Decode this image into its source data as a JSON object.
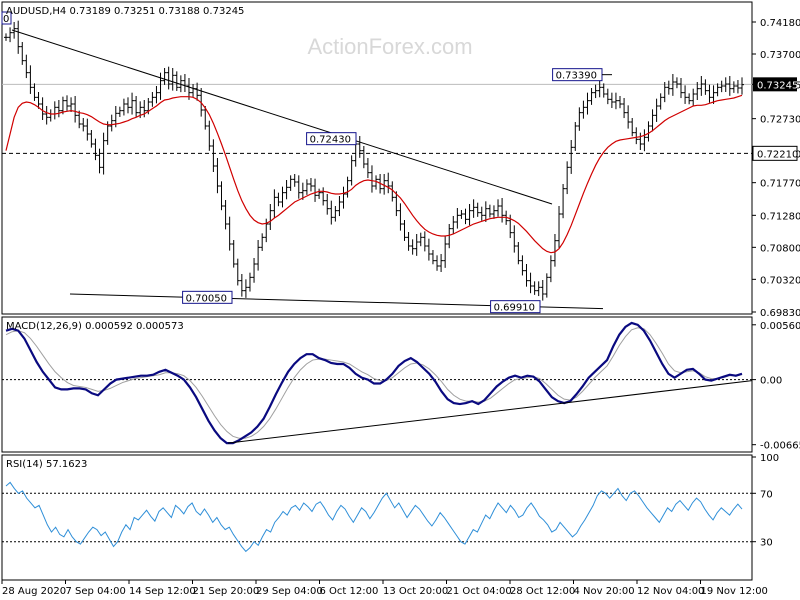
{
  "chart_data": [
    {
      "type": "candlestick",
      "title": "AUDUSD,H4  0.73189 0.73251 0.73188 0.73245",
      "corner_tag": "0",
      "ylim": [
        0.6983,
        0.7445
      ],
      "yticks": [
        "0.74180",
        "0.73700",
        "0.73245",
        "0.72730",
        "0.72210",
        "0.71770",
        "0.71280",
        "0.70800",
        "0.70320",
        "0.69830"
      ],
      "current_price_label": "0.73245",
      "marked_level_label": "0.72210",
      "annotations": [
        "0.73390",
        "0.72430",
        "0.70050",
        "0.69910"
      ],
      "close_series": [
        0.7395,
        0.7402,
        0.7408,
        0.7381,
        0.736,
        0.7342,
        0.732,
        0.7305,
        0.7295,
        0.728,
        0.7275,
        0.728,
        0.729,
        0.7285,
        0.73,
        0.7292,
        0.7295,
        0.7278,
        0.7265,
        0.7262,
        0.725,
        0.7235,
        0.7218,
        0.72,
        0.724,
        0.7262,
        0.727,
        0.7281,
        0.7285,
        0.7295,
        0.729,
        0.73,
        0.7282,
        0.729,
        0.7285,
        0.7298,
        0.7305,
        0.7312,
        0.733,
        0.7342,
        0.7325,
        0.7338,
        0.732,
        0.733,
        0.7322,
        0.7312,
        0.7318,
        0.7308,
        0.7286,
        0.7262,
        0.7232,
        0.7202,
        0.7172,
        0.7142,
        0.7115,
        0.7085,
        0.7055,
        0.703,
        0.7015,
        0.702,
        0.7035,
        0.7055,
        0.708,
        0.7095,
        0.7115,
        0.7135,
        0.7155,
        0.7148,
        0.7162,
        0.717,
        0.7182,
        0.7178,
        0.7162,
        0.7165,
        0.7175,
        0.7172,
        0.7158,
        0.7162,
        0.715,
        0.7138,
        0.7125,
        0.7135,
        0.7148,
        0.716,
        0.718,
        0.721,
        0.7235,
        0.7225,
        0.7205,
        0.7192,
        0.7172,
        0.7182,
        0.7168,
        0.718,
        0.7172,
        0.7155,
        0.7135,
        0.7115,
        0.7095,
        0.7082,
        0.7078,
        0.7088,
        0.7095,
        0.7082,
        0.707,
        0.706,
        0.7052,
        0.706,
        0.7085,
        0.7108,
        0.7118,
        0.7128,
        0.713,
        0.7122,
        0.7135,
        0.714,
        0.7132,
        0.7128,
        0.7138,
        0.713,
        0.7135,
        0.7142,
        0.7128,
        0.712,
        0.7102,
        0.7082,
        0.706,
        0.7045,
        0.703,
        0.7022,
        0.7015,
        0.702,
        0.701,
        0.7035,
        0.706,
        0.709,
        0.713,
        0.7168,
        0.72,
        0.723,
        0.7262,
        0.7282,
        0.729,
        0.73,
        0.7312,
        0.7315,
        0.732,
        0.731,
        0.7302,
        0.7298,
        0.73,
        0.7295,
        0.7282,
        0.7268,
        0.7252,
        0.7242,
        0.7235,
        0.7245,
        0.7262,
        0.7278,
        0.7292,
        0.7305,
        0.732,
        0.7318,
        0.7328,
        0.7325,
        0.7312,
        0.7305,
        0.73,
        0.731,
        0.7318,
        0.7325,
        0.7315,
        0.7305,
        0.7312,
        0.732,
        0.7322,
        0.7325,
        0.7318,
        0.7322,
        0.7319,
        0.7324
      ],
      "ma_series": [
        0.7225,
        0.725,
        0.7275,
        0.729,
        0.7296,
        0.7298,
        0.7297,
        0.7294,
        0.729,
        0.7285,
        0.7282,
        0.728,
        0.728,
        0.7281,
        0.7283,
        0.7284,
        0.7285,
        0.7284,
        0.7282,
        0.7281,
        0.7279,
        0.7276,
        0.7272,
        0.7268,
        0.7265,
        0.7264,
        0.7264,
        0.7265,
        0.7266,
        0.7268,
        0.727,
        0.7273,
        0.7275,
        0.7278,
        0.728,
        0.7284,
        0.7288,
        0.7292,
        0.7297,
        0.7301,
        0.7302,
        0.7304,
        0.7305,
        0.7306,
        0.7306,
        0.7306,
        0.7305,
        0.7302,
        0.7297,
        0.7289,
        0.7279,
        0.7266,
        0.7251,
        0.7235,
        0.7218,
        0.72,
        0.7182,
        0.7165,
        0.715,
        0.7138,
        0.7128,
        0.7121,
        0.7117,
        0.7115,
        0.7116,
        0.7119,
        0.7124,
        0.7128,
        0.7133,
        0.7138,
        0.7143,
        0.7148,
        0.7151,
        0.7154,
        0.7157,
        0.716,
        0.7162,
        0.7164,
        0.7164,
        0.7163,
        0.7161,
        0.716,
        0.716,
        0.7161,
        0.7163,
        0.7167,
        0.7173,
        0.7177,
        0.718,
        0.7181,
        0.718,
        0.7179,
        0.7176,
        0.7173,
        0.717,
        0.7166,
        0.716,
        0.7154,
        0.7146,
        0.7137,
        0.7128,
        0.712,
        0.7113,
        0.7107,
        0.7103,
        0.71,
        0.7098,
        0.7097,
        0.7097,
        0.7098,
        0.71,
        0.7103,
        0.7106,
        0.7109,
        0.7112,
        0.7115,
        0.7117,
        0.7119,
        0.7121,
        0.7123,
        0.7124,
        0.7125,
        0.7125,
        0.7125,
        0.7123,
        0.712,
        0.7116,
        0.711,
        0.7104,
        0.7097,
        0.709,
        0.7084,
        0.7078,
        0.7074,
        0.7072,
        0.7073,
        0.7078,
        0.7087,
        0.7099,
        0.7113,
        0.7129,
        0.7145,
        0.7161,
        0.7176,
        0.719,
        0.7203,
        0.7214,
        0.7223,
        0.723,
        0.7235,
        0.7239,
        0.7241,
        0.7242,
        0.7243,
        0.7244,
        0.7245,
        0.7246,
        0.7248,
        0.7251,
        0.7255,
        0.726,
        0.7265,
        0.727,
        0.7274,
        0.7277,
        0.728,
        0.7283,
        0.7286,
        0.7289,
        0.7292,
        0.7293,
        0.7293,
        0.7294,
        0.7296,
        0.7298,
        0.73,
        0.7301,
        0.7302,
        0.7303,
        0.7304,
        0.7306,
        0.7308
      ]
    },
    {
      "type": "line",
      "title": "MACD(12,26,9) 0.000592 0.000573",
      "ylim": [
        -0.0072,
        0.0062
      ],
      "yticks": [
        "0.005607",
        "0.00",
        "-0.006656"
      ],
      "macd_series": [
        0.005,
        0.0052,
        0.005,
        0.0042,
        0.003,
        0.0018,
        0.0008,
        0.0,
        -0.0008,
        -0.001,
        -0.001,
        -0.0009,
        -0.0009,
        -0.001,
        -0.0014,
        -0.0016,
        -0.001,
        -0.0004,
        0.0,
        0.0001,
        0.0002,
        0.0003,
        0.0004,
        0.0004,
        0.0005,
        0.0008,
        0.001,
        0.0007,
        0.0004,
        0.0,
        -0.0008,
        -0.0018,
        -0.003,
        -0.0042,
        -0.0052,
        -0.006,
        -0.0065,
        -0.0065,
        -0.0062,
        -0.0058,
        -0.0054,
        -0.0048,
        -0.004,
        -0.0028,
        -0.0015,
        -0.0003,
        0.0008,
        0.0016,
        0.0022,
        0.0026,
        0.0026,
        0.0022,
        0.002,
        0.0017,
        0.0016,
        0.0016,
        0.0012,
        0.0006,
        0.0002,
        0.0,
        -0.0004,
        -0.0004,
        0.0,
        0.0006,
        0.0014,
        0.0019,
        0.0022,
        0.0018,
        0.0012,
        0.0006,
        -0.0002,
        -0.0012,
        -0.002,
        -0.0024,
        -0.0025,
        -0.0024,
        -0.0022,
        -0.0025,
        -0.0021,
        -0.0014,
        -0.0007,
        -0.0002,
        0.0002,
        0.0004,
        0.0002,
        0.0004,
        0.0003,
        -0.0002,
        -0.001,
        -0.0018,
        -0.0022,
        -0.0024,
        -0.0022,
        -0.0015,
        -0.0007,
        0.0002,
        0.0008,
        0.0014,
        0.002,
        0.0034,
        0.0046,
        0.0054,
        0.0058,
        0.0056,
        0.005,
        0.004,
        0.0028,
        0.0016,
        0.0006,
        0.0002,
        0.0006,
        0.001,
        0.0011,
        0.0006,
        0.0,
        -0.0001,
        0.0001,
        0.0003,
        0.0005,
        0.0004,
        0.0006
      ],
      "signal_series": [
        0.0046,
        0.0049,
        0.005,
        0.0048,
        0.0042,
        0.0034,
        0.0025,
        0.0016,
        0.0008,
        0.0002,
        -0.0003,
        -0.0006,
        -0.0007,
        -0.0008,
        -0.001,
        -0.0012,
        -0.0011,
        -0.0009,
        -0.0006,
        -0.0003,
        -0.0001,
        0.0001,
        0.0002,
        0.0003,
        0.0004,
        0.0005,
        0.0007,
        0.0007,
        0.0006,
        0.0004,
        -0.0001,
        -0.0008,
        -0.0017,
        -0.0027,
        -0.0037,
        -0.0046,
        -0.0053,
        -0.0058,
        -0.006,
        -0.006,
        -0.0058,
        -0.0054,
        -0.0048,
        -0.004,
        -0.003,
        -0.0019,
        -0.0008,
        0.0002,
        0.001,
        0.0016,
        0.002,
        0.0021,
        0.0021,
        0.002,
        0.0019,
        0.0018,
        0.0016,
        0.0012,
        0.0008,
        0.0005,
        0.0001,
        -0.0001,
        -0.0001,
        0.0002,
        0.0007,
        0.0012,
        0.0016,
        0.0017,
        0.0015,
        0.0011,
        0.0005,
        -0.0002,
        -0.001,
        -0.0016,
        -0.002,
        -0.0022,
        -0.0022,
        -0.0023,
        -0.0022,
        -0.0019,
        -0.0014,
        -0.0009,
        -0.0004,
        0.0,
        0.0001,
        0.0002,
        0.0003,
        0.0001,
        -0.0004,
        -0.001,
        -0.0016,
        -0.002,
        -0.0021,
        -0.0018,
        -0.0012,
        -0.0005,
        0.0002,
        0.0008,
        0.0014,
        0.0024,
        0.0035,
        0.0044,
        0.0051,
        0.0053,
        0.0052,
        0.0046,
        0.0037,
        0.0027,
        0.0016,
        0.0009,
        0.0007,
        0.0008,
        0.0009,
        0.0007,
        0.0003,
        0.0001,
        0.0001,
        0.0002,
        0.0004,
        0.0004,
        0.0005
      ]
    },
    {
      "type": "line",
      "title": "RSI(14) 57.1623",
      "ylim": [
        0,
        100
      ],
      "yticks": [
        "100",
        "70",
        "30",
        "0"
      ],
      "rsi_series": [
        76,
        79,
        74,
        70,
        72,
        66,
        62,
        58,
        60,
        52,
        44,
        38,
        42,
        36,
        34,
        40,
        34,
        30,
        28,
        33,
        38,
        42,
        40,
        35,
        38,
        32,
        26,
        30,
        38,
        44,
        40,
        50,
        48,
        52,
        56,
        51,
        47,
        55,
        58,
        54,
        50,
        60,
        57,
        53,
        59,
        62,
        55,
        52,
        57,
        52,
        46,
        50,
        44,
        40,
        42,
        36,
        31,
        26,
        22,
        25,
        30,
        27,
        34,
        40,
        38,
        46,
        50,
        55,
        52,
        58,
        60,
        56,
        62,
        59,
        55,
        61,
        63,
        58,
        52,
        48,
        55,
        60,
        57,
        51,
        46,
        52,
        58,
        55,
        49,
        54,
        60,
        66,
        70,
        64,
        58,
        62,
        56,
        50,
        55,
        60,
        57,
        52,
        47,
        43,
        48,
        54,
        50,
        45,
        40,
        35,
        30,
        28,
        34,
        40,
        38,
        45,
        52,
        49,
        56,
        62,
        58,
        54,
        60,
        56,
        50,
        52,
        58,
        62,
        57,
        51,
        48,
        44,
        38,
        40,
        46,
        42,
        38,
        34,
        37,
        43,
        48,
        54,
        60,
        68,
        72,
        70,
        66,
        70,
        74,
        68,
        64,
        70,
        72,
        68,
        63,
        58,
        54,
        50,
        46,
        52,
        58,
        55,
        61,
        64,
        60,
        56,
        62,
        66,
        63,
        57,
        52,
        48,
        54,
        58,
        55,
        52,
        57,
        61,
        57
      ]
    }
  ],
  "x_axis_labels": [
    "28 Aug 2020",
    "7 Sep 04:00",
    "14 Sep 12:00",
    "21 Sep 20:00",
    "29 Sep 04:00",
    "6 Oct 12:00",
    "13 Oct 20:00",
    "21 Oct 04:00",
    "28 Oct 12:00",
    "4 Nov 20:00",
    "12 Nov 04:00",
    "19 Nov 12:00"
  ],
  "watermark": "ActionForex.com",
  "colors": {
    "bars": "#000000",
    "moving_average": "#d00000",
    "trendline": "#000000",
    "macd_line": "#0a0a80",
    "signal_line": "#a0a0a0",
    "rsi_line": "#2f8fd8",
    "label_box": "#14148c",
    "watermark": "#d8d8d8"
  }
}
